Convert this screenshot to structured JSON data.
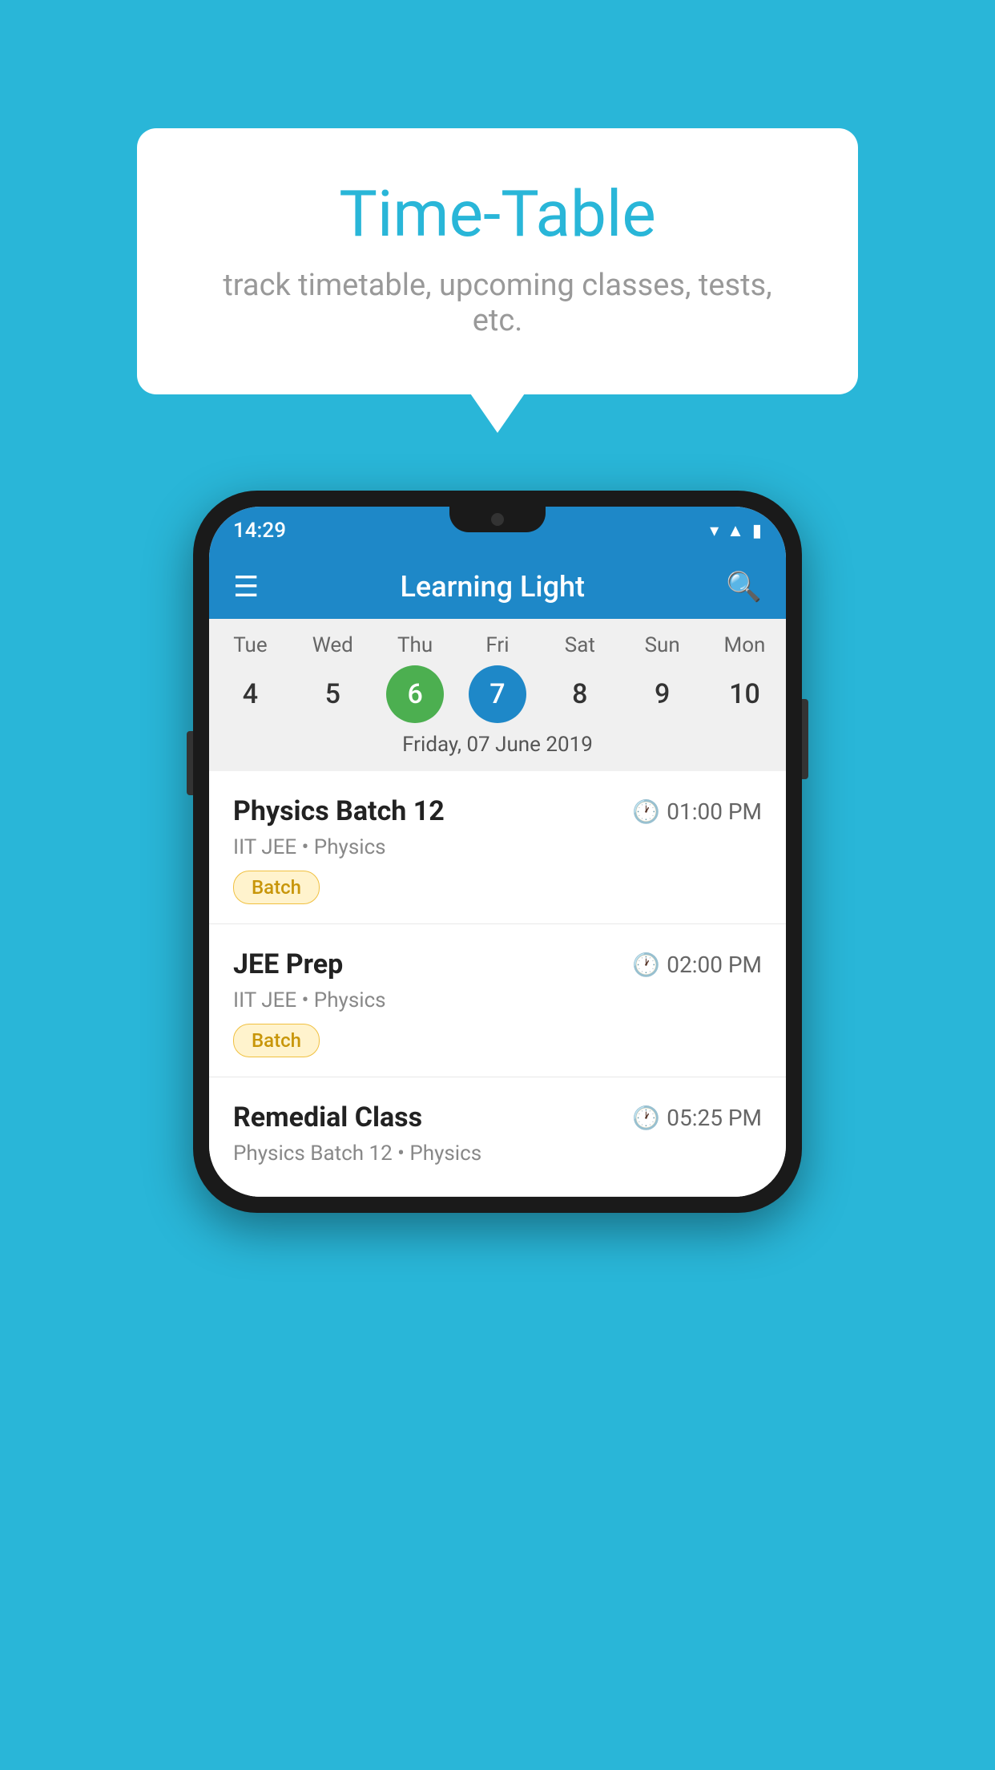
{
  "background_color": "#29b6d8",
  "tooltip": {
    "title": "Time-Table",
    "subtitle": "track timetable, upcoming classes, tests, etc."
  },
  "phone": {
    "status_bar": {
      "time": "14:29"
    },
    "app_bar": {
      "title": "Learning Light"
    },
    "calendar": {
      "days": [
        {
          "label": "Tue",
          "num": "4"
        },
        {
          "label": "Wed",
          "num": "5"
        },
        {
          "label": "Thu",
          "num": "6",
          "state": "today"
        },
        {
          "label": "Fri",
          "num": "7",
          "state": "selected"
        },
        {
          "label": "Sat",
          "num": "8"
        },
        {
          "label": "Sun",
          "num": "9"
        },
        {
          "label": "Mon",
          "num": "10"
        }
      ],
      "date_label": "Friday, 07 June 2019"
    },
    "schedule": [
      {
        "title": "Physics Batch 12",
        "time": "01:00 PM",
        "meta": "IIT JEE • Physics",
        "badge": "Batch"
      },
      {
        "title": "JEE Prep",
        "time": "02:00 PM",
        "meta": "IIT JEE • Physics",
        "badge": "Batch"
      },
      {
        "title": "Remedial Class",
        "time": "05:25 PM",
        "meta": "Physics Batch 12 • Physics",
        "badge": null
      }
    ]
  }
}
